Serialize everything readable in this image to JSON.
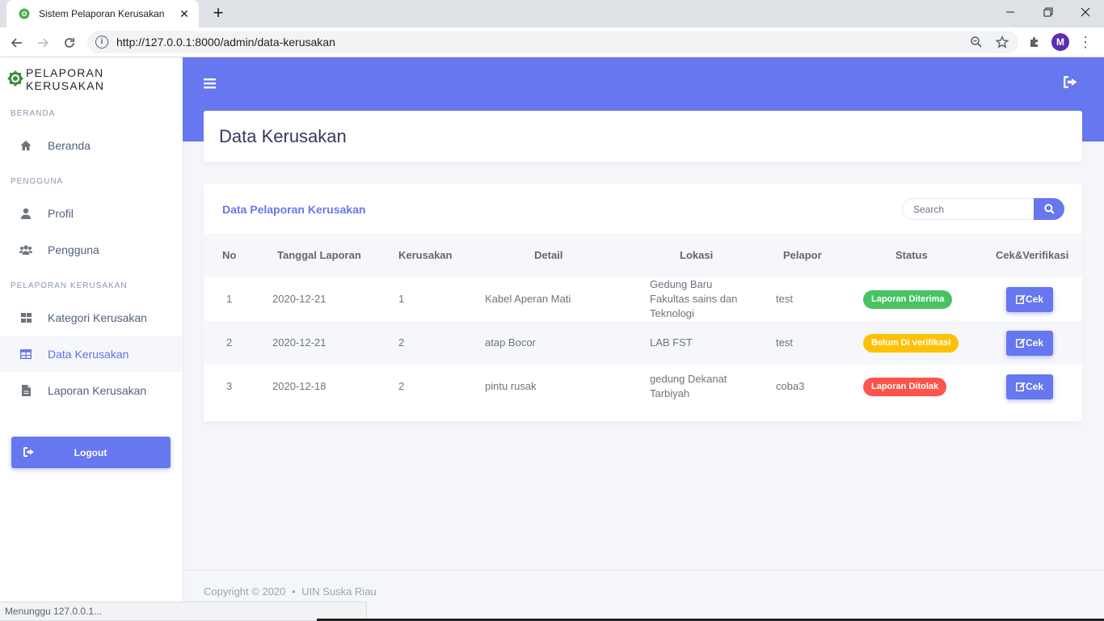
{
  "browser": {
    "tab_title": "Sistem Pelaporan Kerusakan",
    "url": "http://127.0.0.1:8000/admin/data-kerusakan",
    "profile_initial": "M",
    "status_text": "Menunggu 127.0.0.1..."
  },
  "sidebar": {
    "brand": "PELAPORAN KERUSAKAN",
    "sections": [
      {
        "heading": "BERANDA",
        "items": [
          {
            "label": "Beranda",
            "icon": "home-icon"
          }
        ]
      },
      {
        "heading": "PENGGUNA",
        "items": [
          {
            "label": "Profil",
            "icon": "user-icon"
          },
          {
            "label": "Pengguna",
            "icon": "users-icon"
          }
        ]
      },
      {
        "heading": "PELAPORAN KERUSAKAN",
        "items": [
          {
            "label": "Kategori Kerusakan",
            "icon": "grid-icon"
          },
          {
            "label": "Data Kerusakan",
            "icon": "table-icon",
            "active": true
          },
          {
            "label": "Laporan Kerusakan",
            "icon": "file-icon"
          }
        ]
      }
    ],
    "logout_label": "Logout"
  },
  "page": {
    "title": "Data Kerusakan"
  },
  "table_card": {
    "title": "Data Pelaporan Kerusakan",
    "search_placeholder": "Search",
    "columns": [
      "No",
      "Tanggal Laporan",
      "Kerusakan",
      "Detail",
      "Lokasi",
      "Pelapor",
      "Status",
      "Cek&Verifikasi"
    ],
    "rows": [
      {
        "no": "1",
        "tanggal": "2020-12-21",
        "kerusakan": "1",
        "detail": "Kabel Aperan Mati",
        "lokasi": "Gedung Baru Fakultas sains dan Teknologi",
        "pelapor": "test",
        "status": "Laporan Diterima",
        "status_color": "#47c363",
        "action": "Cek"
      },
      {
        "no": "2",
        "tanggal": "2020-12-21",
        "kerusakan": "2",
        "detail": "atap Bocor",
        "lokasi": "LAB FST",
        "pelapor": "test",
        "status": "Belum Di verifikasi",
        "status_color": "#ffc107",
        "action": "Cek"
      },
      {
        "no": "3",
        "tanggal": "2020-12-18",
        "kerusakan": "2",
        "detail": "pintu rusak",
        "lokasi": "gedung Dekanat Tarbiyah",
        "pelapor": "coba3",
        "status": "Laporan Ditolak",
        "status_color": "#fc544b",
        "action": "Cek"
      }
    ]
  },
  "footer": {
    "copyright": "Copyright © 2020",
    "separator": "•",
    "org": "UIN Suska Riau"
  },
  "colors": {
    "primary": "#6777ef",
    "success": "#47c363",
    "warning": "#ffc107",
    "danger": "#fc544b"
  }
}
